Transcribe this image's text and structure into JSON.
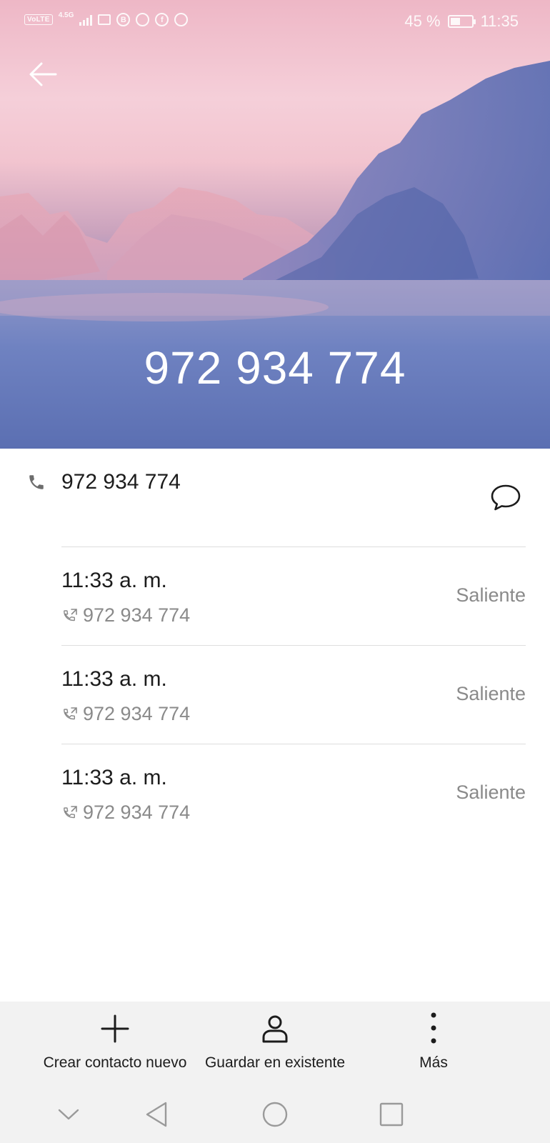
{
  "status_bar": {
    "volte": "VoLTE",
    "network": "4.5G",
    "battery": "45 %",
    "battery_level": 0.45,
    "time": "11:35",
    "icons": [
      "volte-icon",
      "signal-icon",
      "message-notification-icon",
      "b-app-icon",
      "chat-bubble-icon",
      "facebook-icon",
      "game-icon"
    ]
  },
  "header": {
    "title": "972 934 774",
    "back_icon": "arrow-left-icon",
    "colors": {
      "sky_top": "#eeb7c6",
      "water": "#5d72b3"
    }
  },
  "contact": {
    "number": "972 934 774",
    "phone_icon": "phone-icon",
    "message_icon": "message-icon"
  },
  "calls": [
    {
      "time": "11:33 a. m.",
      "number": "972 934 774",
      "type": "Saliente",
      "icon": "outgoing-call-icon"
    },
    {
      "time": "11:33 a. m.",
      "number": "972 934 774",
      "type": "Saliente",
      "icon": "outgoing-call-icon"
    },
    {
      "time": "11:33 a. m.",
      "number": "972 934 774",
      "type": "Saliente",
      "icon": "outgoing-call-icon"
    }
  ],
  "actions": {
    "create": {
      "label": "Crear contacto nuevo",
      "icon": "plus-icon"
    },
    "save": {
      "label": "Guardar en existente",
      "icon": "person-icon"
    },
    "more": {
      "label": "Más",
      "icon": "more-vertical-icon"
    }
  },
  "nav": [
    "chevron-down-icon",
    "back-triangle-icon",
    "home-circle-icon",
    "recents-square-icon"
  ]
}
